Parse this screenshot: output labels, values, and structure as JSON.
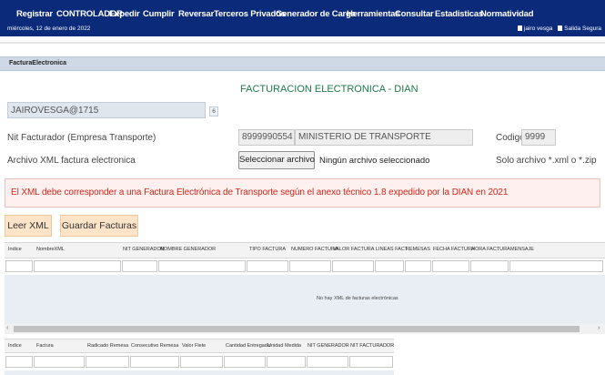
{
  "nav": {
    "menu": [
      "Registrar",
      "CONTROLADOR",
      "Expedir",
      "Cumplir",
      "Reversar",
      "Terceros Privados",
      "Generador de Carga",
      "Herramientas",
      "Consultar",
      "Estadisticas",
      "Normatividad"
    ],
    "date": "miércoles, 12 de enero de 2022",
    "user": "jairo vesga",
    "logout": "Salida Segura"
  },
  "page": {
    "band_title": "FacturaElectronica",
    "title": "FACTURACION ELECTRONICA - DIAN"
  },
  "session": {
    "user_value": "JAIROVESGA@1715",
    "user_badge": "6"
  },
  "form": {
    "nit_label": "Nit Facturador (Empresa Transporte)",
    "nit_value": "8999990554",
    "company_value": "MINISTERIO DE TRANSPORTE",
    "codigo_label": "Codigo",
    "codigo_value": "9999",
    "xml_label": "Archivo XML factura electronica",
    "file_button": "Seleccionar archivo",
    "file_status": "Ningún archivo seleccionado",
    "file_hint": "Solo archivo *.xml o *.zip"
  },
  "alert": {
    "message": "El XML debe corresponder a una Factura Electrónica de Transporte según el anexo técnico 1.8 expedido por la DIAN en 2021"
  },
  "actions": {
    "read_xml": "Leer XML",
    "save_invoices": "Guardar Facturas"
  },
  "grid1": {
    "columns": [
      "Indice",
      "NombreXML",
      "NIT GENERADOR",
      "NOMBRE GENERADOR",
      "TIPO FACTURA",
      "NUMERO FACTURA",
      "VALOR FACTURA",
      "LINEAS FACT",
      "REMESAS",
      "FECHA FACTURA",
      "HORA FACTURA",
      "MENSAJE"
    ],
    "empty_message": "No hay XML de facturas electrónicas",
    "scroll_left": "‹",
    "scroll_right": "›"
  },
  "grid2": {
    "columns": [
      "Indice",
      "Factura",
      "Radicado Remesa",
      "Consecutivo Remesa",
      "Valor Flete",
      "Cantidad Entregada",
      "Unidad Medida",
      "NIT GENERADOR",
      "NIT FACTURADOR"
    ]
  },
  "colors": {
    "nav_bg": "#0b2a7a",
    "title_green": "#1e7a4a",
    "alert_red": "#d4271b",
    "action_orange": "#fde3c8"
  }
}
